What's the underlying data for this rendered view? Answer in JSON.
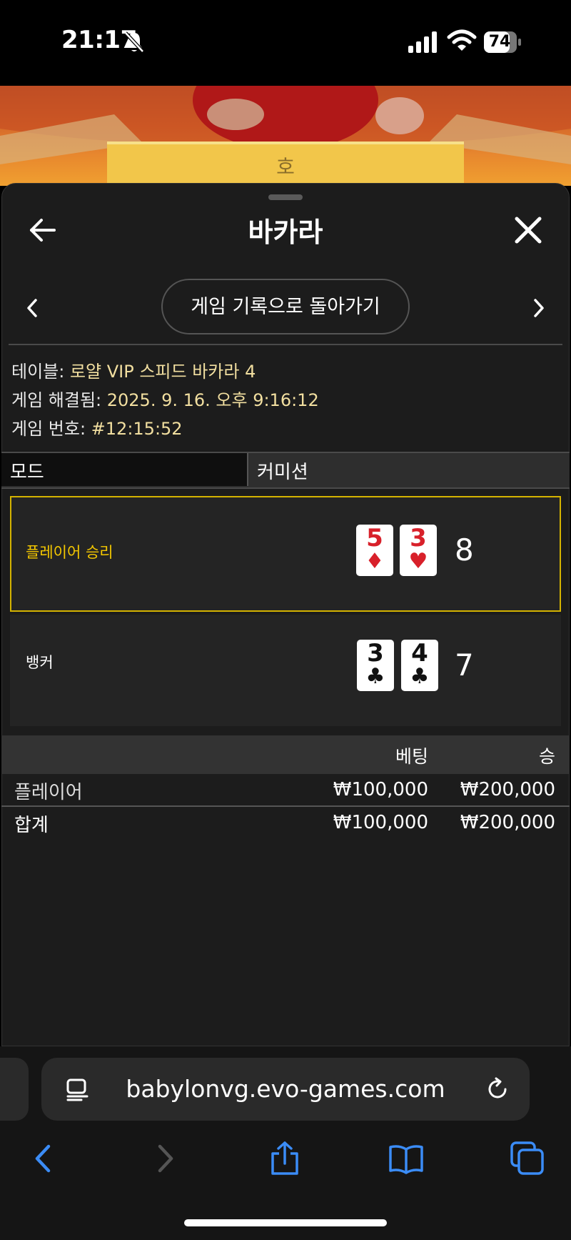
{
  "status_bar": {
    "time": "21:17",
    "battery": "74"
  },
  "video": {
    "overlay_text": "호"
  },
  "sheet": {
    "title": "바카라",
    "return_button": "게임 기록으로 돌아가기",
    "info": {
      "table_label": "테이블: ",
      "table_value": "로얄 VIP 스피드 바카라 4",
      "resolved_label": "게임 해결됨: ",
      "resolved_value": "2025. 9. 16. 오후 9:16:12",
      "game_number_label": "게임 번호: ",
      "game_number_value": "#12:15:52"
    },
    "mode": {
      "label": "모드",
      "value": "커미션"
    },
    "hands": {
      "player": {
        "label": "플레이어 승리",
        "cards": [
          {
            "rank": "5",
            "suit": "♦"
          },
          {
            "rank": "3",
            "suit": "♥"
          }
        ],
        "score": "8"
      },
      "banker": {
        "label": "뱅커",
        "cards": [
          {
            "rank": "3",
            "suit": "♣"
          },
          {
            "rank": "4",
            "suit": "♣"
          }
        ],
        "score": "7"
      }
    },
    "bets": {
      "columns": {
        "bet": "베팅",
        "win": "승"
      },
      "rows": [
        {
          "label": "플레이어",
          "bet": "₩100,000",
          "win": "₩200,000"
        }
      ],
      "total": {
        "label": "합계",
        "bet": "₩100,000",
        "win": "₩200,000"
      }
    }
  },
  "browser": {
    "url": "babylonvg.evo-games.com"
  },
  "icons": {
    "back": "arrow-left-icon",
    "close": "close-icon",
    "prev": "chevron-left-icon",
    "next": "chevron-right-icon",
    "reader": "reader-icon",
    "reload": "reload-icon",
    "share": "share-icon",
    "bookmarks": "book-icon",
    "tabs": "tabs-icon"
  },
  "colors": {
    "accent_gold": "#f5c800",
    "value_text": "#f2dfa0",
    "browser_blue": "#3b8cf6"
  }
}
